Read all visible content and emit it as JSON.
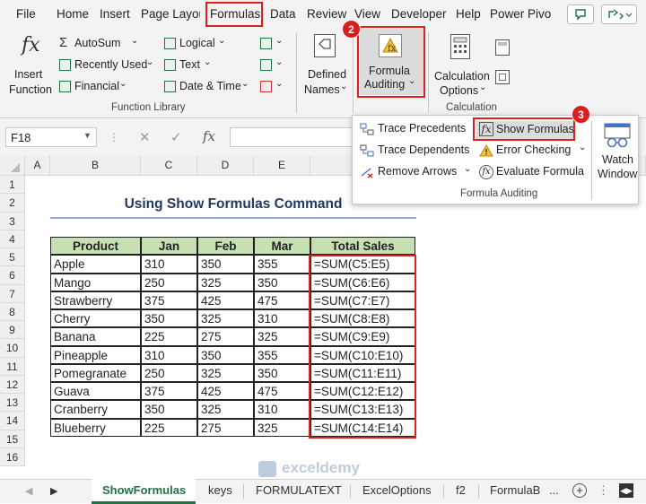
{
  "menu": [
    "File",
    "Home",
    "Insert",
    "Page Layou",
    "Formulas",
    "Data",
    "Review",
    "View",
    "Developer",
    "Help",
    "Power Pivo"
  ],
  "badges": {
    "b1": "1",
    "b2": "2",
    "b3": "3"
  },
  "ribbon": {
    "insert_function": [
      "Insert",
      "Function"
    ],
    "autosum": "AutoSum",
    "recently_used": "Recently Used",
    "financial": "Financial",
    "logical": "Logical",
    "text": "Text",
    "date_time": "Date & Time",
    "function_library": "Function Library",
    "defined_names": [
      "Defined",
      "Names"
    ],
    "formula_auditing": [
      "Formula",
      "Auditing"
    ],
    "calc_options": [
      "Calculation",
      "Options"
    ],
    "calculation": "Calculation"
  },
  "formula_bar": {
    "name_box": "F18",
    "fx": "fx"
  },
  "dropdown": {
    "trace_precedents": "Trace Precedents",
    "trace_dependents": "Trace Dependents",
    "remove_arrows": "Remove Arrows",
    "show_formulas": "Show Formulas",
    "error_checking": "Error Checking",
    "evaluate_formula": "Evaluate Formula",
    "group_label": "Formula Auditing",
    "watch_window": [
      "Watch",
      "Window"
    ]
  },
  "columns": [
    "A",
    "B",
    "C",
    "D",
    "E",
    "F"
  ],
  "rows": [
    "1",
    "2",
    "3",
    "4",
    "5",
    "6",
    "7",
    "8",
    "9",
    "10",
    "11",
    "12",
    "13",
    "14",
    "15",
    "16"
  ],
  "title": "Using Show Formulas Command",
  "table": {
    "headers": [
      "Product",
      "Jan",
      "Feb",
      "Mar",
      "Total Sales"
    ],
    "rows": [
      [
        "Apple",
        "310",
        "350",
        "355",
        "=SUM(C5:E5)"
      ],
      [
        "Mango",
        "250",
        "325",
        "350",
        "=SUM(C6:E6)"
      ],
      [
        "Strawberry",
        "375",
        "425",
        "475",
        "=SUM(C7:E7)"
      ],
      [
        "Cherry",
        "350",
        "325",
        "310",
        "=SUM(C8:E8)"
      ],
      [
        "Banana",
        "225",
        "275",
        "325",
        "=SUM(C9:E9)"
      ],
      [
        "Pineapple",
        "310",
        "350",
        "355",
        "=SUM(C10:E10)"
      ],
      [
        "Pomegranate",
        "250",
        "325",
        "350",
        "=SUM(C11:E11)"
      ],
      [
        "Guava",
        "375",
        "425",
        "475",
        "=SUM(C12:E12)"
      ],
      [
        "Cranberry",
        "350",
        "325",
        "310",
        "=SUM(C13:E13)"
      ],
      [
        "Blueberry",
        "225",
        "275",
        "325",
        "=SUM(C14:E14)"
      ]
    ]
  },
  "tabs": [
    "ShowFormulas",
    "keys",
    "FORMULATEXT",
    "ExcelOptions",
    "f2",
    "FormulaB",
    "..."
  ],
  "watermark": "exceldemy",
  "colors": {
    "header_green": "#c6e0b4",
    "accent_red": "#e0201c",
    "excel_green": "#217346"
  }
}
